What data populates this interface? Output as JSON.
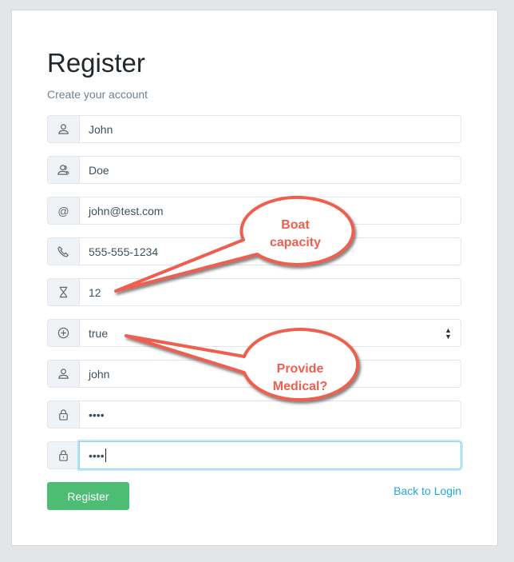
{
  "title": "Register",
  "subtitle": "Create your account",
  "fields": [
    {
      "icon": "user-icon",
      "value": "John"
    },
    {
      "icon": "users-icon",
      "value": "Doe"
    },
    {
      "icon": "at-icon",
      "value": "john@test.com"
    },
    {
      "icon": "phone-icon",
      "value": "555-555-1234"
    },
    {
      "icon": "hourglass-icon",
      "value": "12"
    },
    {
      "icon": "plus-circle-icon",
      "value": "true"
    },
    {
      "icon": "user-icon",
      "value": "john"
    },
    {
      "icon": "lock-icon",
      "value": "••••"
    },
    {
      "icon": "lock-icon",
      "value": "••••"
    }
  ],
  "register_label": "Register",
  "back_label": "Back to Login",
  "callouts": {
    "boat": [
      "Boat",
      "capacity"
    ],
    "medical": [
      "Provide",
      "Medical?"
    ]
  },
  "colors": {
    "accent_green": "#4dbd74",
    "link": "#20a8d8",
    "callout": "#ef5f4f"
  }
}
